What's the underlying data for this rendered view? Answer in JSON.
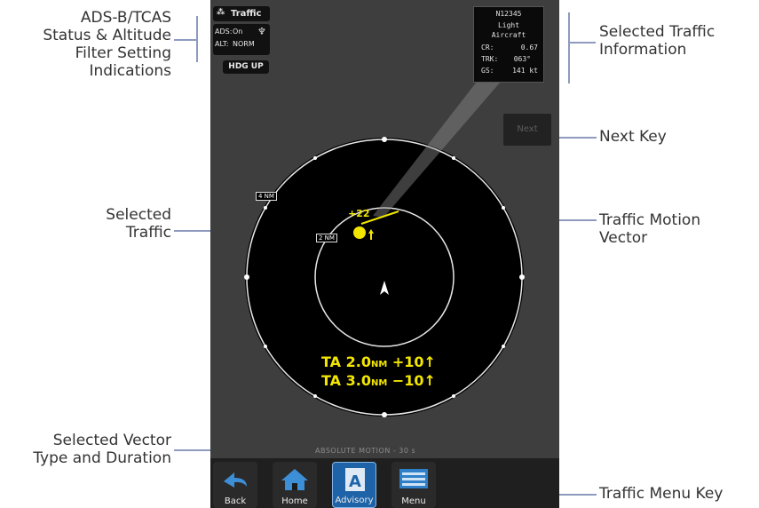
{
  "callouts": {
    "status_lines": [
      "ADS-B/TCAS",
      "Status & Altitude",
      "Filter Setting",
      "Indications"
    ],
    "selected_traffic_info_lines": [
      "Selected Traffic",
      "Information"
    ],
    "next_key": "Next Key",
    "selected_traffic_lines": [
      "Selected",
      "Traffic"
    ],
    "motion_vector_lines": [
      "Traffic Motion",
      "Vector"
    ],
    "vector_type_lines": [
      "Selected Vector",
      "Type and Duration"
    ],
    "traffic_menu_key": "Traffic Menu Key"
  },
  "screen": {
    "title_button": "Traffic",
    "ads_label": "ADS:",
    "ads_value": "On",
    "alt_label": "ALT:",
    "alt_value": "NORM",
    "orientation": "HDG UP",
    "next_button": "Next",
    "info": {
      "callsign": "N12345",
      "type_line1": "Light",
      "type_line2": "Aircraft",
      "cr_label": "CR:",
      "cr_value": "0.67",
      "trk_label": "TRK:",
      "trk_value": "063°",
      "gs_label": "GS:",
      "gs_value": "141 kt"
    },
    "range_outer": "4 NM",
    "range_inner": "2 NM",
    "target_altitude": "+22",
    "alerts": [
      {
        "text": "TA 2.0",
        "unit": "NM",
        "tail": "+10↑"
      },
      {
        "text": "TA 3.0",
        "unit": "NM",
        "tail": "−10↑"
      }
    ],
    "vector_label": "ABSOLUTE MOTION - 30 s",
    "menu_keys": [
      "Back",
      "Home",
      "Advisory",
      "Menu"
    ]
  },
  "colors": {
    "traffic_yellow": "#f2e600",
    "screen_bg": "#3e3e3e",
    "active_key": "#1e63a8",
    "callout_line": "#8e9bbf"
  }
}
